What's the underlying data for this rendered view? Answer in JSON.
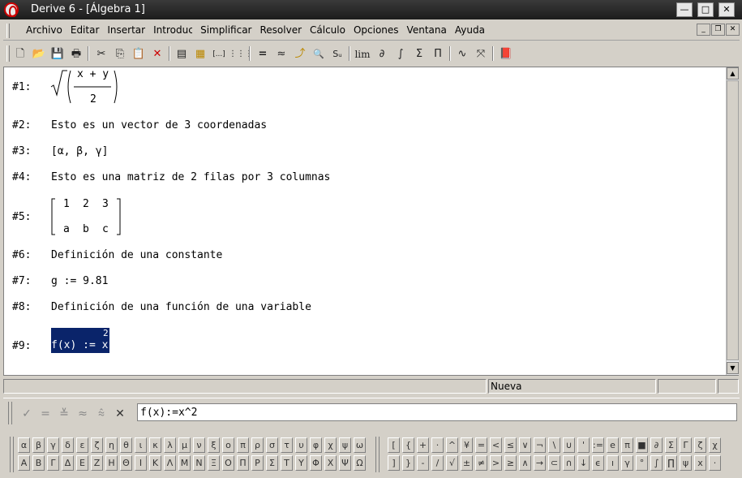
{
  "window": {
    "title": "Derive 6 - [Álgebra 1]",
    "controls": {
      "minimize": "—",
      "maximize": "□",
      "close": "✕"
    }
  },
  "menu": {
    "items": [
      "Archivo",
      "Editar",
      "Insertar",
      "Introducir",
      "Simplificar",
      "Resolver",
      "Cálculo",
      "Opciones",
      "Ventana",
      "Ayuda"
    ],
    "mdi_controls": {
      "minimize": "_",
      "restore": "❐",
      "close": "✕"
    }
  },
  "toolbar": {
    "icons": [
      {
        "name": "new-file-icon",
        "glyph": "🗋"
      },
      {
        "name": "open-folder-icon",
        "glyph": "📂"
      },
      {
        "name": "save-icon",
        "glyph": "💾"
      },
      {
        "name": "print-icon",
        "glyph": "🖶"
      },
      {
        "name": "cut-icon",
        "glyph": "✂"
      },
      {
        "name": "copy-icon",
        "glyph": "⎘"
      },
      {
        "name": "paste-icon",
        "glyph": "📋"
      },
      {
        "name": "delete-icon",
        "glyph": "✕"
      },
      {
        "name": "insert-text-icon",
        "glyph": "▤"
      },
      {
        "name": "insert-note-icon",
        "glyph": "▦"
      },
      {
        "name": "vector-icon",
        "glyph": "[...]"
      },
      {
        "name": "matrix-icon",
        "glyph": "⋮⋮⋮"
      },
      {
        "name": "equals-simplify-icon",
        "glyph": "="
      },
      {
        "name": "approximate-icon",
        "glyph": "≈"
      },
      {
        "name": "solve-icon",
        "glyph": "⤴"
      },
      {
        "name": "find-icon",
        "glyph": "🔍"
      },
      {
        "name": "substitute-icon",
        "glyph": "Sᵤ"
      },
      {
        "name": "limit-icon",
        "glyph": "lim"
      },
      {
        "name": "derivative-icon",
        "glyph": "∂"
      },
      {
        "name": "integral-icon",
        "glyph": "∫"
      },
      {
        "name": "sum-icon",
        "glyph": "Σ"
      },
      {
        "name": "product-icon",
        "glyph": "Π"
      },
      {
        "name": "plot-2d-icon",
        "glyph": "∿"
      },
      {
        "name": "plot-3d-icon",
        "glyph": "⤧"
      },
      {
        "name": "help-book-icon",
        "glyph": "📕"
      }
    ]
  },
  "algebra": {
    "expressions": [
      {
        "label": "#1:",
        "kind": "sqrt",
        "numerator": "x + y",
        "denominator": "2"
      },
      {
        "label": "#2:",
        "kind": "text",
        "text": "Esto es un vector de 3 coordenadas"
      },
      {
        "label": "#3:",
        "kind": "text",
        "text": "[α, β, γ]"
      },
      {
        "label": "#4:",
        "kind": "text",
        "text": "Esto es una matriz de 2 filas por 3 columnas"
      },
      {
        "label": "#5:",
        "kind": "matrix",
        "row1": [
          "1",
          "2",
          "3"
        ],
        "row2": [
          "a",
          "b",
          "c"
        ]
      },
      {
        "label": "#6:",
        "kind": "text",
        "text": "Definición de una constante"
      },
      {
        "label": "#7:",
        "kind": "text",
        "text": "g := 9.81"
      },
      {
        "label": "#8:",
        "kind": "text",
        "text": "Definición de una función de una variable"
      },
      {
        "label": "#9:",
        "kind": "power",
        "base": "f(x) := x",
        "exponent": "2",
        "selected": true
      }
    ]
  },
  "status": {
    "text": "Nueva"
  },
  "entry": {
    "value": "f(x):=x^2",
    "buttons": [
      "✓",
      "=",
      "≚",
      "≈",
      "⩯",
      "✕"
    ]
  },
  "palettes": {
    "greek_lower": [
      "α",
      "β",
      "γ",
      "δ",
      "ε",
      "ζ",
      "η",
      "θ",
      "ι",
      "κ",
      "λ",
      "μ",
      "ν",
      "ξ",
      "ο",
      "π",
      "ρ",
      "σ",
      "τ",
      "υ",
      "φ",
      "χ",
      "ψ",
      "ω"
    ],
    "greek_upper": [
      "Α",
      "Β",
      "Γ",
      "Δ",
      "Ε",
      "Ζ",
      "Η",
      "Θ",
      "Ι",
      "Κ",
      "Λ",
      "Μ",
      "Ν",
      "Ξ",
      "Ο",
      "Π",
      "Ρ",
      "Σ",
      "Τ",
      "Υ",
      "Φ",
      "Χ",
      "Ψ",
      "Ω"
    ],
    "math_row1": [
      "[",
      "{",
      "+",
      "·",
      "^",
      "¥",
      "=",
      "<",
      "≤",
      "∨",
      "¬",
      "\\",
      "∪",
      "'",
      ":=",
      "e",
      "π",
      "■",
      "∂",
      "Σ",
      "Γ",
      "ζ",
      "χ"
    ],
    "math_row2": [
      "]",
      "}",
      "-",
      "/",
      "√",
      "±",
      "≠",
      ">",
      "≥",
      "∧",
      "→",
      "⊂",
      "∩",
      "↓",
      "ϵ",
      "ı",
      "γ",
      "°",
      "∫",
      "∏",
      "ψ",
      "ⅹ",
      "·"
    ]
  },
  "colors": {
    "selection": "#0a246a",
    "window_bg": "#ffffff",
    "chrome": "#d4d0c8"
  }
}
